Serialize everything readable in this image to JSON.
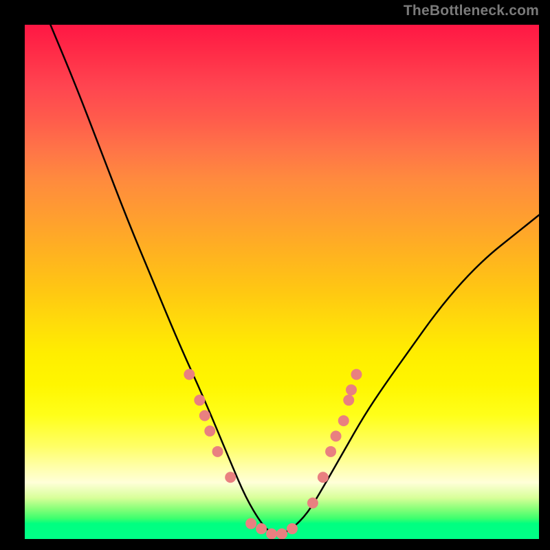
{
  "attribution": "TheBottleneck.com",
  "chart_data": {
    "type": "line",
    "title": "",
    "xlabel": "",
    "ylabel": "",
    "xlim": [
      0,
      100
    ],
    "ylim": [
      0,
      100
    ],
    "background": "red-yellow-green vertical gradient",
    "curve": {
      "description": "Asymmetric V-shaped bottleneck curve with minimum around x≈48, left tail goes to 100, right tail to ≈63",
      "x": [
        5,
        10,
        15,
        20,
        25,
        30,
        35,
        40,
        43,
        46,
        48,
        50,
        52,
        55,
        58,
        62,
        66,
        70,
        75,
        80,
        85,
        90,
        95,
        100
      ],
      "y": [
        100,
        88,
        75,
        62,
        50,
        38,
        27,
        15,
        8,
        3,
        1,
        1,
        2,
        5,
        10,
        17,
        24,
        30,
        37,
        44,
        50,
        55,
        59,
        63
      ]
    },
    "markers": {
      "description": "Salmon-colored circular markers clustered near the trough and lower arms of the V",
      "points": [
        {
          "x": 32,
          "y": 32
        },
        {
          "x": 34,
          "y": 27
        },
        {
          "x": 35,
          "y": 24
        },
        {
          "x": 36,
          "y": 21
        },
        {
          "x": 37.5,
          "y": 17
        },
        {
          "x": 40,
          "y": 12
        },
        {
          "x": 44,
          "y": 3
        },
        {
          "x": 46,
          "y": 2
        },
        {
          "x": 48,
          "y": 1
        },
        {
          "x": 50,
          "y": 1
        },
        {
          "x": 52,
          "y": 2
        },
        {
          "x": 56,
          "y": 7
        },
        {
          "x": 58,
          "y": 12
        },
        {
          "x": 59.5,
          "y": 17
        },
        {
          "x": 60.5,
          "y": 20
        },
        {
          "x": 62,
          "y": 23
        },
        {
          "x": 63,
          "y": 27
        },
        {
          "x": 63.5,
          "y": 29
        },
        {
          "x": 64.5,
          "y": 32
        }
      ],
      "color": "#e98080",
      "radius": 8
    }
  }
}
